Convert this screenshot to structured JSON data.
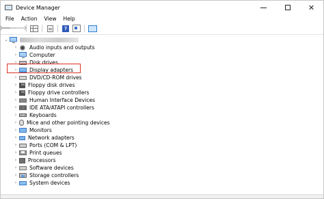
{
  "window": {
    "title": "Device Manager",
    "minimize_glyph": "",
    "maximize_glyph": "",
    "close_glyph": "✕"
  },
  "menu": [
    "File",
    "Action",
    "View",
    "Help"
  ],
  "toolbar": {
    "back_glyph": "🡐",
    "forward_glyph": "🡒",
    "help_glyph": "?"
  },
  "tree": {
    "collapse_glyph": "⌄",
    "expand_glyph": "›",
    "categories": [
      {
        "label": "Audio inputs and outputs",
        "icon": "speaker-icon"
      },
      {
        "label": "Computer",
        "icon": "computer-icon"
      },
      {
        "label": "Disk drives",
        "icon": "disk-drive-icon"
      },
      {
        "label": "Display adapters",
        "icon": "display-adapter-icon"
      },
      {
        "label": "DVD/CD-ROM drives",
        "icon": "dvd-drive-icon"
      },
      {
        "label": "Floppy disk drives",
        "icon": "floppy-disk-icon"
      },
      {
        "label": "Floppy drive controllers",
        "icon": "floppy-controller-icon"
      },
      {
        "label": "Human Interface Devices",
        "icon": "hid-icon"
      },
      {
        "label": "IDE ATA/ATAPI controllers",
        "icon": "ide-controller-icon"
      },
      {
        "label": "Keyboards",
        "icon": "keyboard-icon"
      },
      {
        "label": "Mice and other pointing devices",
        "icon": "mouse-icon"
      },
      {
        "label": "Monitors",
        "icon": "monitor-icon"
      },
      {
        "label": "Network adapters",
        "icon": "network-adapter-icon"
      },
      {
        "label": "Ports (COM & LPT)",
        "icon": "port-icon"
      },
      {
        "label": "Print queues",
        "icon": "printer-icon"
      },
      {
        "label": "Processors",
        "icon": "processor-icon"
      },
      {
        "label": "Software devices",
        "icon": "software-device-icon"
      },
      {
        "label": "Storage controllers",
        "icon": "storage-controller-icon"
      },
      {
        "label": "System devices",
        "icon": "system-device-icon"
      }
    ]
  }
}
